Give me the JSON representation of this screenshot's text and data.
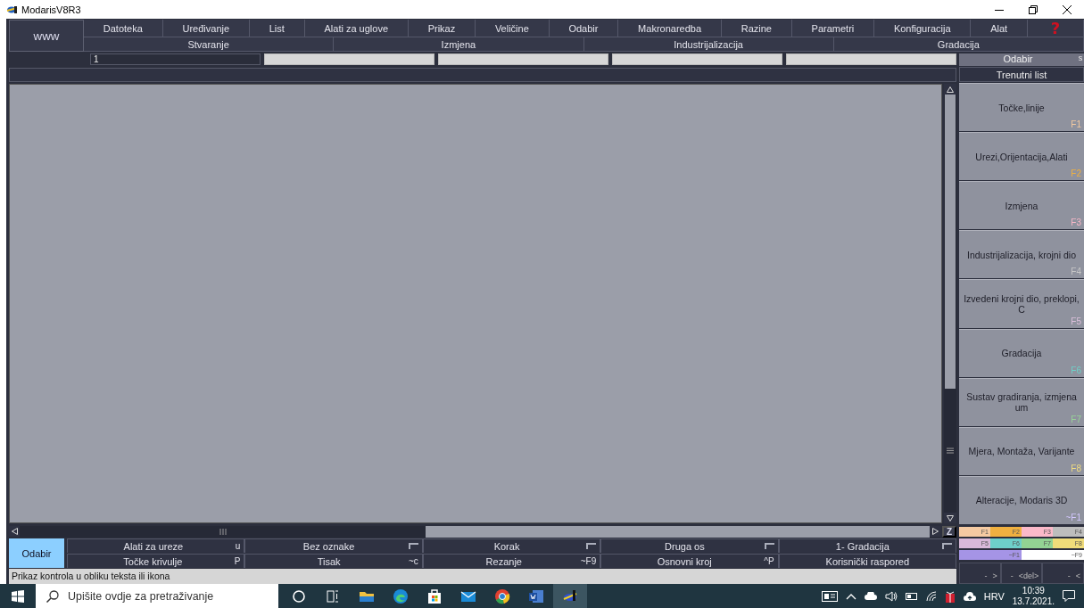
{
  "window": {
    "title": "ModarisV8R3"
  },
  "menu": {
    "home": "www",
    "items": [
      {
        "label": "Datoteka"
      },
      {
        "label": "Uređivanje"
      },
      {
        "label": "List"
      },
      {
        "label": "Alati za uglove"
      },
      {
        "label": "Prikaz"
      },
      {
        "label": "Veličine"
      },
      {
        "label": "Odabir"
      },
      {
        "label": "Makronaredba"
      },
      {
        "label": "Razine"
      },
      {
        "label": "Parametri"
      },
      {
        "label": "Konfiguracija"
      },
      {
        "label": "Alat"
      }
    ],
    "help": "?"
  },
  "submenu": [
    "Stvaranje",
    "Izmjena",
    "Industrijalizacija",
    "Gradacija"
  ],
  "fields": [
    {
      "kind": "dark",
      "value": "1"
    },
    {
      "kind": "light"
    },
    {
      "kind": "light"
    },
    {
      "kind": "light"
    },
    {
      "kind": "light"
    }
  ],
  "side_panel": {
    "select_button": "Odabir",
    "select_suffix": "s",
    "current": "Trenutni list",
    "functions": [
      {
        "label": "Točke,linije",
        "key": "F1",
        "color": "#f4c9a0"
      },
      {
        "label": "Urezi,Orijentacija,Alati",
        "key": "F2",
        "color": "#eeb040"
      },
      {
        "label": "Izmjena",
        "key": "F3",
        "color": "#f8b8c8"
      },
      {
        "label": "Industrijalizacija, krojni dio",
        "key": "F4",
        "color": "#c8c8c8"
      },
      {
        "label": "Izvedeni krojni dio, preklopi, C",
        "key": "F5",
        "color": "#dcc0dc"
      },
      {
        "label": "Gradacija",
        "key": "F6",
        "color": "#6fd0c8"
      },
      {
        "label": "Sustav gradiranja, izmjena um",
        "key": "F7",
        "color": "#98d498"
      },
      {
        "label": "Mjera, Montaža, Varijante",
        "key": "F8",
        "color": "#f0dc80"
      },
      {
        "label": "Alteracije, Modaris 3D",
        "key": "~F1",
        "color": "#d4c8ff"
      }
    ]
  },
  "key_grid": [
    {
      "label": "F1",
      "color": "#f5caa2"
    },
    {
      "label": "F2",
      "color": "#f0b040"
    },
    {
      "label": "F3",
      "color": "#fbb9c9"
    },
    {
      "label": "F4",
      "color": "#bdbdbd"
    },
    {
      "label": "F5",
      "color": "#d9b9d9"
    },
    {
      "label": "F6",
      "color": "#6ecfc9"
    },
    {
      "label": "F7",
      "color": "#93d393"
    },
    {
      "label": "F8",
      "color": "#f0dc7a"
    },
    {
      "label": "~F1",
      "color": "#a594e6"
    },
    {
      "label": "~F9",
      "color": "#ffffff"
    }
  ],
  "nav_buttons": [
    {
      "dash": "-",
      "sign": ">"
    },
    {
      "dash": "-",
      "sign": "<del>"
    },
    {
      "dash": "-",
      "sign": "<"
    }
  ],
  "scrollbar": {
    "corner": "Z"
  },
  "toolbar": {
    "primary": "Odabir",
    "rows": [
      [
        {
          "label": "Alati za ureze",
          "kind": "shortcut",
          "shortcut": "u"
        },
        {
          "label": "Bez oznake",
          "kind": "flag"
        },
        {
          "label": "Korak",
          "kind": "flag"
        },
        {
          "label": "Druga os",
          "kind": "flag"
        },
        {
          "label": "1- Gradacija",
          "kind": "flag"
        }
      ],
      [
        {
          "label": "Točke krivulje",
          "kind": "shortcut",
          "shortcut": "P"
        },
        {
          "label": "Tisak",
          "kind": "shortcut",
          "shortcut": "~c"
        },
        {
          "label": "Rezanje",
          "kind": "shortcut",
          "shortcut": "~F9"
        },
        {
          "label": "Osnovni kroj",
          "kind": "shortcut",
          "shortcut": "^P"
        },
        {
          "label": "Korisnički raspored",
          "kind": "plain"
        }
      ]
    ]
  },
  "status_bar": "Prikaz kontrola u obliku teksta ili ikona",
  "taskbar": {
    "search_placeholder": "Upišite ovdje za pretraživanje",
    "apps": [
      {
        "kind": "cortana",
        "selected": false
      },
      {
        "kind": "taskview",
        "selected": false
      },
      {
        "kind": "folder",
        "selected": false
      },
      {
        "kind": "edge",
        "selected": false
      },
      {
        "kind": "store",
        "selected": false
      },
      {
        "kind": "mail",
        "selected": false
      },
      {
        "kind": "chrome",
        "selected": false
      },
      {
        "kind": "word",
        "selected": false
      },
      {
        "kind": "modaris",
        "selected": true
      }
    ],
    "language": "HRV",
    "time": "10:39",
    "date": "13.7.2021."
  }
}
